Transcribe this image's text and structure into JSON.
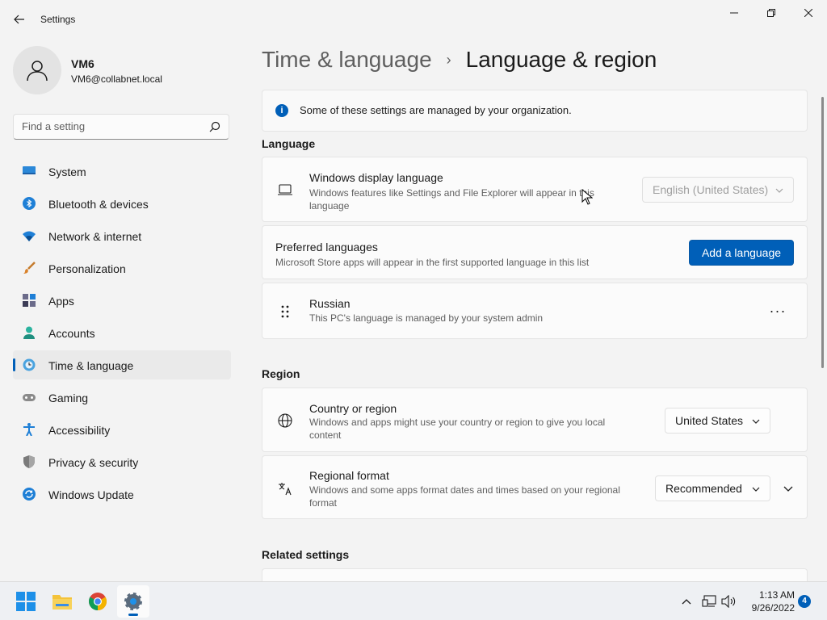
{
  "window": {
    "title": "Settings"
  },
  "profile": {
    "name": "VM6",
    "email": "VM6@collabnet.local"
  },
  "search": {
    "placeholder": "Find a setting"
  },
  "nav": {
    "items": [
      {
        "label": "System",
        "icon": "monitor-icon"
      },
      {
        "label": "Bluetooth & devices",
        "icon": "bluetooth-icon"
      },
      {
        "label": "Network & internet",
        "icon": "wifi-icon"
      },
      {
        "label": "Personalization",
        "icon": "brush-icon"
      },
      {
        "label": "Apps",
        "icon": "apps-icon"
      },
      {
        "label": "Accounts",
        "icon": "person-icon"
      },
      {
        "label": "Time & language",
        "icon": "clock-globe-icon",
        "active": true
      },
      {
        "label": "Gaming",
        "icon": "gamepad-icon"
      },
      {
        "label": "Accessibility",
        "icon": "accessibility-icon"
      },
      {
        "label": "Privacy & security",
        "icon": "shield-icon"
      },
      {
        "label": "Windows Update",
        "icon": "update-icon"
      }
    ]
  },
  "breadcrumb": {
    "parent": "Time & language",
    "separator": "›",
    "current": "Language & region"
  },
  "info": {
    "text": "Some of these settings are managed by your organization."
  },
  "language": {
    "heading": "Language",
    "display": {
      "title": "Windows display language",
      "desc": "Windows features like Settings and File Explorer will appear in this language",
      "value": "English (United States)"
    },
    "preferred": {
      "title": "Preferred languages",
      "desc": "Microsoft Store apps will appear in the first supported language in this list",
      "button": "Add a language"
    },
    "russian": {
      "title": "Russian",
      "desc": "This PC's language is managed by your system admin",
      "more": "···"
    }
  },
  "region": {
    "heading": "Region",
    "country": {
      "title": "Country or region",
      "desc": "Windows and apps might use your country or region to give you local content",
      "value": "United States"
    },
    "format": {
      "title": "Regional format",
      "desc": "Windows and some apps format dates and times based on your regional format",
      "value": "Recommended"
    }
  },
  "related": {
    "heading": "Related settings"
  },
  "taskbar": {
    "time": "1:13 AM",
    "date": "9/26/2022",
    "notifications": "4"
  },
  "colors": {
    "accent": "#005fb8",
    "background": "#f3f3f3",
    "card": "#fbfbfb"
  }
}
